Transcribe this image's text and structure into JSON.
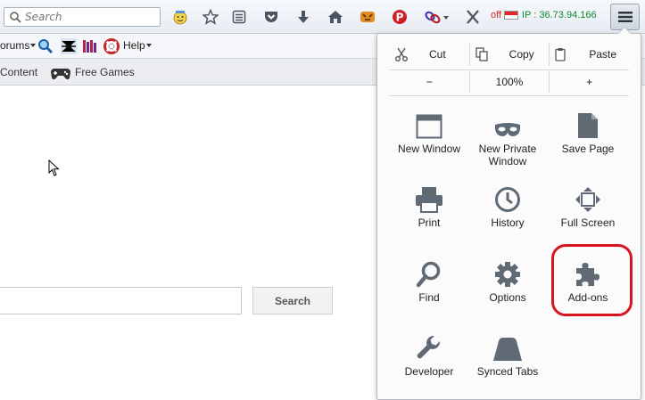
{
  "toolbar": {
    "search_placeholder": "Search",
    "ip_status": "off",
    "ip_text": "IP : 36.73.94.166"
  },
  "bookmarks_bar": {
    "forums_label": "orums",
    "help_label": "Help"
  },
  "third_bar": {
    "content_label": "Content",
    "free_games_label": "Free Games"
  },
  "page": {
    "search_button_label": "Search"
  },
  "menu_panel": {
    "cut_label": "Cut",
    "copy_label": "Copy",
    "paste_label": "Paste",
    "zoom_out_label": "−",
    "zoom_level": "100%",
    "zoom_in_label": "+",
    "items": [
      {
        "label": "New Window",
        "icon": "new-window-icon"
      },
      {
        "label": "New Private Window",
        "icon": "private-mask-icon"
      },
      {
        "label": "Save Page",
        "icon": "save-page-icon"
      },
      {
        "label": "Print",
        "icon": "printer-icon"
      },
      {
        "label": "History",
        "icon": "clock-icon"
      },
      {
        "label": "Full Screen",
        "icon": "fullscreen-icon"
      },
      {
        "label": "Find",
        "icon": "magnifier-icon"
      },
      {
        "label": "Options",
        "icon": "gear-icon"
      },
      {
        "label": "Add-ons",
        "icon": "puzzle-icon"
      },
      {
        "label": "Developer",
        "icon": "wrench-icon"
      },
      {
        "label": "Synced Tabs",
        "icon": "synced-tabs-icon"
      }
    ]
  },
  "colors": {
    "icon_gray": "#5f6a75",
    "highlight_red": "#d8151d",
    "ip_green": "#128a2a",
    "off_red": "#d9261c"
  }
}
